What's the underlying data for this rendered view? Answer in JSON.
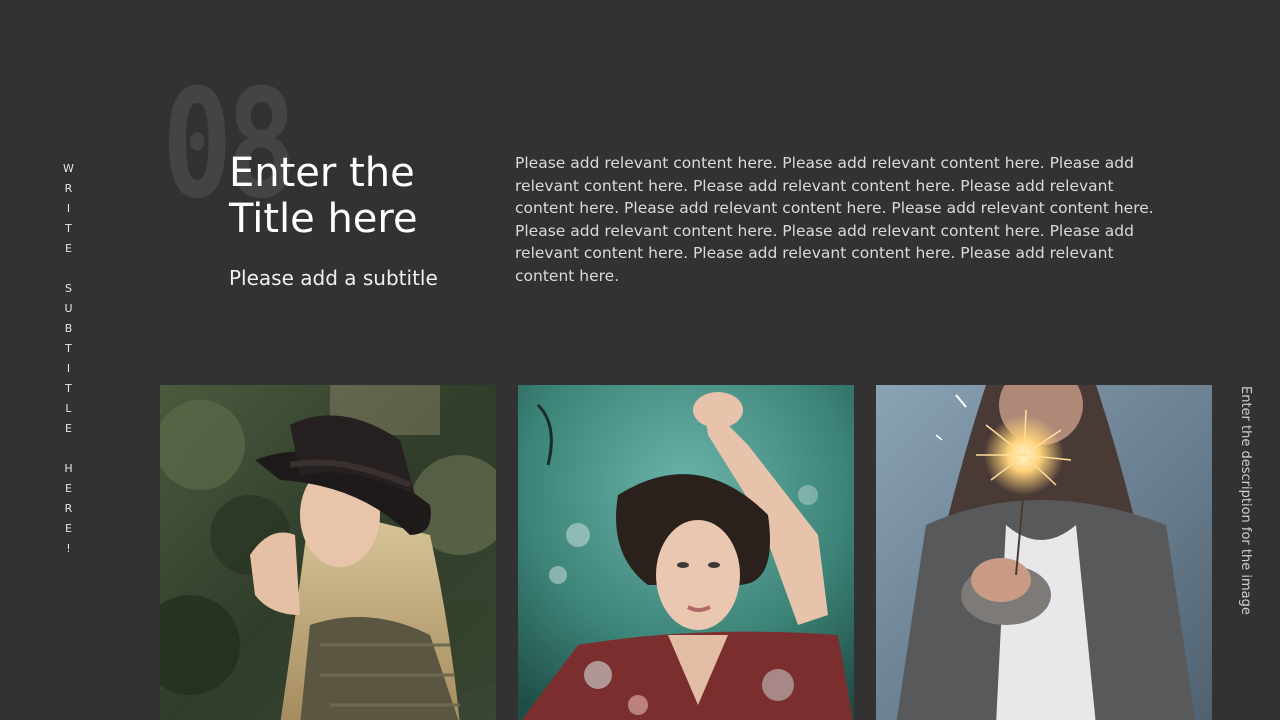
{
  "slide": {
    "side_subtitle": "WRITE SUBTITLE HERE!",
    "number": "08",
    "title": "Enter the Title here",
    "subtitle": "Please add a subtitle",
    "body": "Please add relevant content here. Please add relevant content here. Please add relevant content here. Please add relevant content here. Please add relevant content here. Please add relevant content here. Please add relevant content here. Please add relevant content here. Please add relevant content here. Please add relevant content here. Please add relevant content here. Please add relevant content here.",
    "image_description": "Enter the description for the image"
  },
  "images": [
    {
      "icon": "portrait-photo-hat-woman"
    },
    {
      "icon": "portrait-photo-woman-in-water"
    },
    {
      "icon": "portrait-photo-sparkler"
    }
  ],
  "colors": {
    "background": "#323233",
    "number": "#444445",
    "text": "#ffffff"
  }
}
